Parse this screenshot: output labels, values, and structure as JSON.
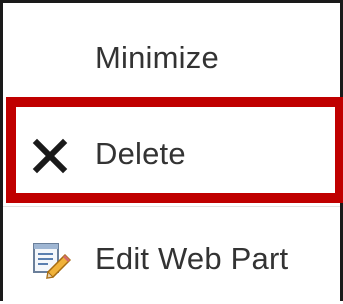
{
  "menu": {
    "items": [
      {
        "label": "Minimize",
        "icon": null
      },
      {
        "label": "Delete",
        "icon": "close-x-icon"
      },
      {
        "label": "Edit Web Part",
        "icon": "edit-web-part-icon"
      }
    ],
    "highlighted_item": "Delete",
    "colors": {
      "highlight_border": "#c00000",
      "text": "#333333",
      "menu_border": "#1a1a1a"
    }
  }
}
